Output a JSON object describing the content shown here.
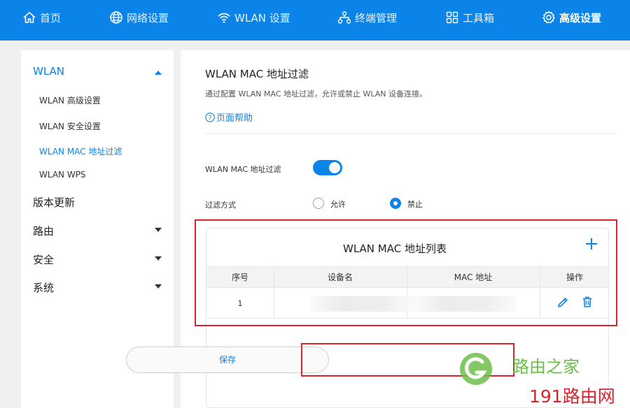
{
  "nav": [
    {
      "label": "首页",
      "icon": "home-icon"
    },
    {
      "label": "网络设置",
      "icon": "globe-icon"
    },
    {
      "label": "WLAN 设置",
      "icon": "wifi-icon"
    },
    {
      "label": "终端管理",
      "icon": "network-topology-icon"
    },
    {
      "label": "工具箱",
      "icon": "grid-icon"
    },
    {
      "label": "高级设置",
      "icon": "gear-icon",
      "active": true
    }
  ],
  "sidebar": {
    "groups": [
      {
        "label": "WLAN",
        "expanded": true,
        "items": [
          "WLAN 高级设置",
          "WLAN 安全设置",
          "WLAN MAC 地址过滤",
          "WLAN WPS"
        ],
        "active_item": 2
      },
      {
        "label": "版本更新"
      },
      {
        "label": "路由"
      },
      {
        "label": "安全"
      },
      {
        "label": "系统"
      }
    ]
  },
  "main": {
    "title": "WLAN MAC 地址过滤",
    "description": "通过配置 WLAN MAC 地址过滤，允许或禁止 WLAN 设备连接。",
    "help_link": "页面帮助",
    "filter_toggle": {
      "label": "WLAN MAC 地址过滤",
      "on": true
    },
    "filter_mode": {
      "label": "过滤方式",
      "options": [
        "允许",
        "禁止"
      ],
      "selected": "禁止"
    },
    "list": {
      "title": "WLAN MAC 地址列表",
      "columns": [
        "序号",
        "设备名",
        "MAC 地址",
        "操作"
      ],
      "rows": [
        {
          "index": "1",
          "device_name": "",
          "mac": ""
        }
      ]
    },
    "save_label": "保存"
  },
  "watermark": {
    "logo_text": "路由之家",
    "site_text": "191路由网"
  },
  "colors": {
    "accent": "#0a84e8",
    "highlight_box": "#d9232e",
    "watermark_green": "#6cc04a",
    "watermark_red": "#d9232e"
  }
}
